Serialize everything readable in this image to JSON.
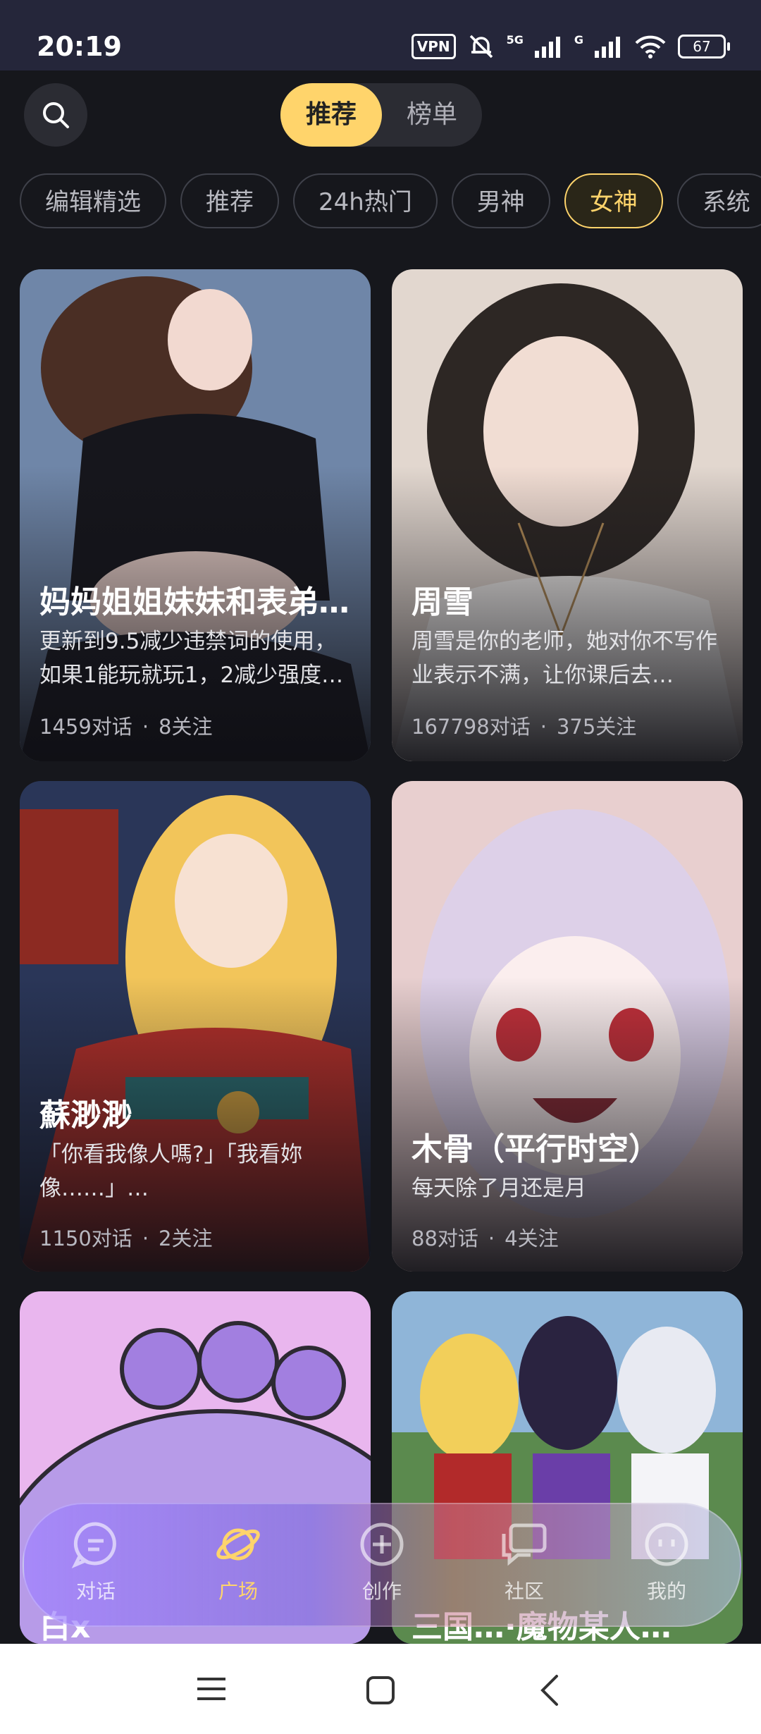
{
  "status": {
    "time": "20:19",
    "vpn": "VPN",
    "signal1": "5G",
    "signal2": "G",
    "battery": "67"
  },
  "header": {
    "toggle_active": "推荐",
    "toggle_inactive": "榜单"
  },
  "categories": [
    "编辑精选",
    "推荐",
    "24h热门",
    "男神",
    "女神",
    "系统"
  ],
  "active_category": "女神",
  "cards": [
    {
      "title": "妈妈姐姐妹妹和表弟…",
      "desc": "更新到9.5减少违禁词的使用，如果1能玩就玩1，2减少强度…",
      "chats": "1459对话",
      "follows": "8关注"
    },
    {
      "title": "周雪",
      "desc": "周雪是你的老师，她对你不写作业表示不满，让你课后去…",
      "chats": "167798对话",
      "follows": "375关注"
    },
    {
      "title": "蘇渺渺",
      "desc": "「你看我像人嗎?」「我看妳像……」…",
      "chats": "1150对话",
      "follows": "2关注"
    },
    {
      "title": "木骨（平行时空）",
      "desc": "每天除了月还是月",
      "chats": "88对话",
      "follows": "4关注"
    },
    {
      "title": "白x",
      "desc": "",
      "chats": "",
      "follows": ""
    },
    {
      "title": "三国…·魔物某人…",
      "desc": "",
      "chats": "",
      "follows": ""
    }
  ],
  "tabs": [
    {
      "label": "对话",
      "icon": "chat-bubble-icon"
    },
    {
      "label": "广场",
      "icon": "planet-icon"
    },
    {
      "label": "创作",
      "icon": "plus-circle-icon"
    },
    {
      "label": "社区",
      "icon": "community-icon"
    },
    {
      "label": "我的",
      "icon": "face-icon"
    }
  ],
  "active_tab": "广场",
  "colors": {
    "accent": "#ffd46b",
    "background": "#16171c",
    "status_bar": "#25263a"
  }
}
